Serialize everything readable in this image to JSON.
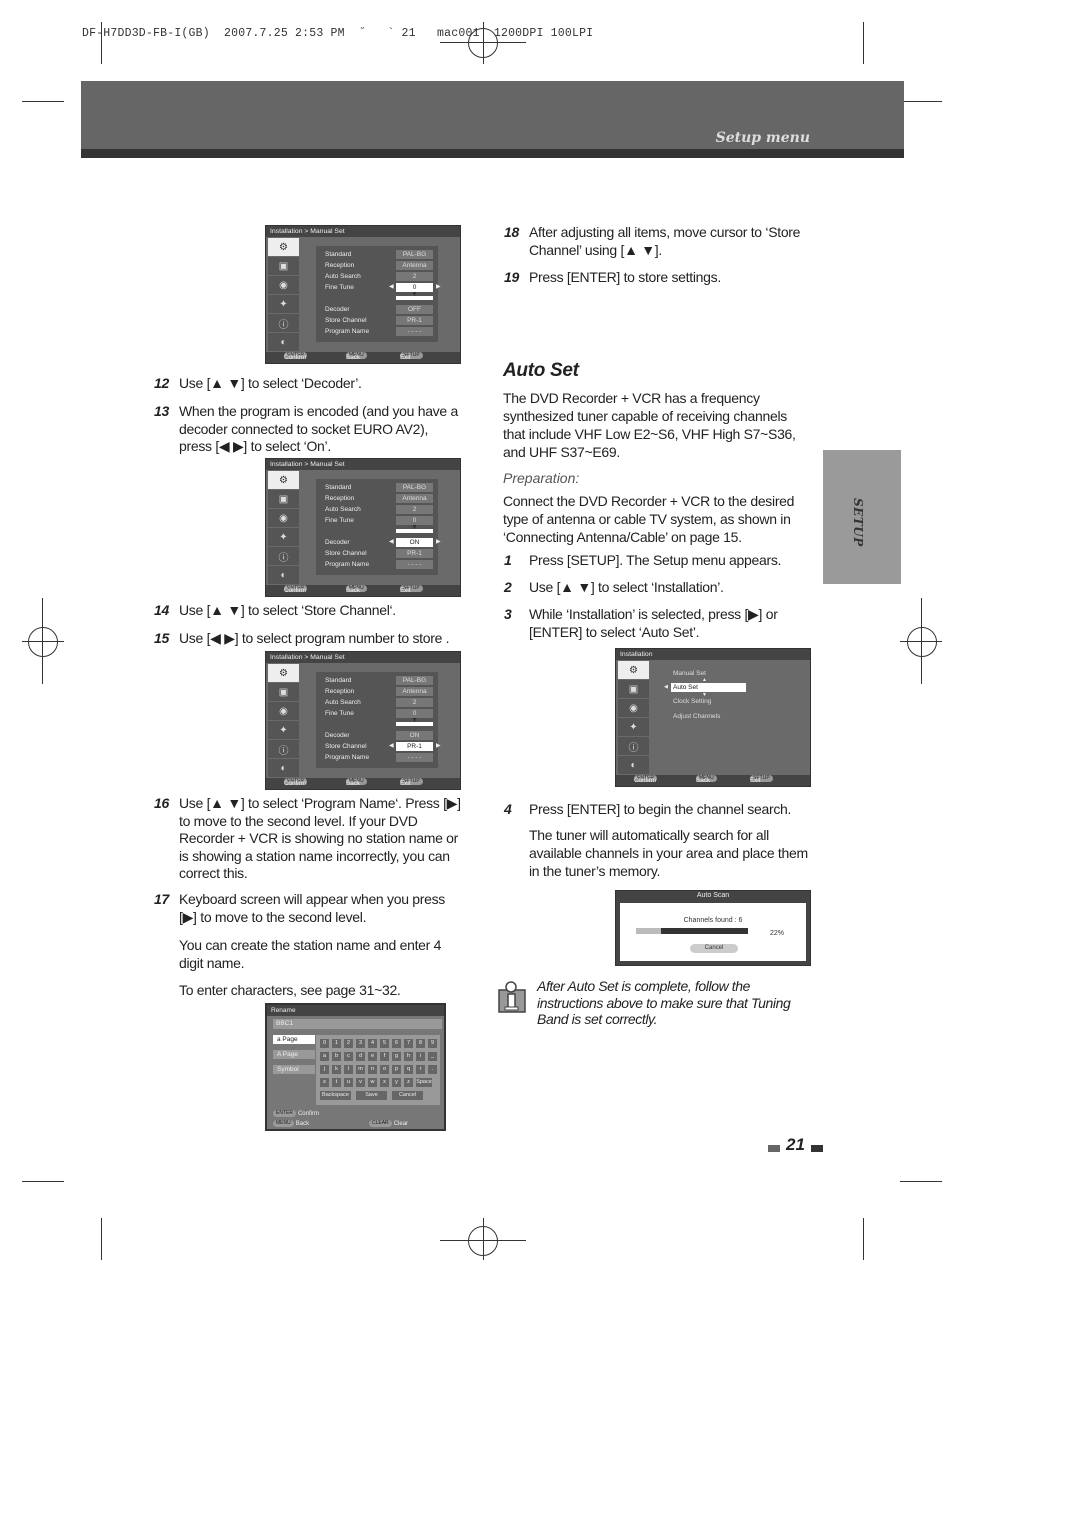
{
  "slug": "DF-H7DD3D-FB-I(GB)  2007.7.25 2:53 PM  ˘   ` 21   mac001  1200DPI 100LPI",
  "header": {
    "section_title": "Setup menu"
  },
  "side_tab": {
    "label": "SETUP"
  },
  "left_column": {
    "steps": [
      {
        "num": "12",
        "text": "Use [▲ ▼] to select ‘Decoder’."
      },
      {
        "num": "13",
        "text": "When the program is encoded (and you have a decoder connected to socket EURO AV2), press [◀ ▶] to select ‘On’."
      },
      {
        "num": "14",
        "text": "Use [▲ ▼] to select ‘Store Channel‘."
      },
      {
        "num": "15",
        "text": "Use [◀ ▶] to select program number to store ."
      },
      {
        "num": "16",
        "text": "Use [▲ ▼] to select ‘Program Name‘. Press [▶] to move to the second level. If your DVD Recorder + VCR is showing no station name or is showing a station name incorrectly, you can correct this."
      },
      {
        "num": "17",
        "text": "Keyboard screen will appear when you press [▶] to move to the second level."
      }
    ],
    "para_station": "You can create the station name and enter 4 digit name.",
    "para_chars": "To enter characters, see page 31~32."
  },
  "manual_set_screens": [
    {
      "breadcrumb": "Installation  > Manual Set",
      "rows": [
        {
          "label": "Standard",
          "value": "PAL-BG"
        },
        {
          "label": "Reception",
          "value": "Antenna"
        },
        {
          "label": "Auto Search",
          "value": "2"
        },
        {
          "label": "Fine Tune",
          "value": "0"
        },
        {
          "label": "Decoder",
          "value": "OFF"
        },
        {
          "label": "Store Channel",
          "value": "PR-1"
        },
        {
          "label": "Program Name",
          "value": "- - - -"
        }
      ],
      "selected": "Fine Tune"
    },
    {
      "breadcrumb": "Installation  > Manual Set",
      "rows": [
        {
          "label": "Standard",
          "value": "PAL-BG"
        },
        {
          "label": "Reception",
          "value": "Antenna"
        },
        {
          "label": "Auto Search",
          "value": "2"
        },
        {
          "label": "Fine Tune",
          "value": "0"
        },
        {
          "label": "Decoder",
          "value": "ON"
        },
        {
          "label": "Store Channel",
          "value": "PR-1"
        },
        {
          "label": "Program Name",
          "value": "- - - -"
        }
      ],
      "selected": "Decoder"
    },
    {
      "breadcrumb": "Installation  > Manual Set",
      "rows": [
        {
          "label": "Standard",
          "value": "PAL-BG"
        },
        {
          "label": "Reception",
          "value": "Antenna"
        },
        {
          "label": "Auto Search",
          "value": "2"
        },
        {
          "label": "Fine Tune",
          "value": "0"
        },
        {
          "label": "Decoder",
          "value": "ON"
        },
        {
          "label": "Store Channel",
          "value": "PR-1"
        },
        {
          "label": "Program Name",
          "value": "- - - -"
        }
      ],
      "selected": "Store Channel"
    }
  ],
  "osd_footer": {
    "enter_key": "ENTER",
    "enter_label": "Confirm",
    "menu_key": "MENU",
    "menu_label": "Back",
    "setup_key": "SETUP",
    "setup_label": "Exit"
  },
  "osd_icons": [
    "installation-icon",
    "recording-icon",
    "language-icon",
    "system-icon",
    "info-icon",
    "disc-icon"
  ],
  "rename_screen": {
    "title": "Rename",
    "name_value": "BBC1",
    "pages": [
      "a Page",
      "A Page",
      "Symbol"
    ],
    "selected_page": "a Page",
    "keys": [
      [
        "0",
        "1",
        "2",
        "3",
        "4",
        "5",
        "6",
        "7",
        "8",
        "9"
      ],
      [
        "a",
        "b",
        "c",
        "d",
        "e",
        "f",
        "g",
        "h",
        "i",
        "_"
      ],
      [
        "j",
        "k",
        "l",
        "m",
        "n",
        "o",
        "p",
        "q",
        "r",
        "."
      ],
      [
        "s",
        "t",
        "u",
        "v",
        "w",
        "x",
        "y",
        "z",
        "Space"
      ]
    ],
    "actions": [
      "Backspace",
      "Save",
      "Cancel"
    ],
    "footer": {
      "enter_key": "ENTER",
      "enter_label": "Confirm",
      "menu_key": "MENU",
      "menu_label": "Back",
      "clear_key": "CLEAR",
      "clear_label": "Clear"
    }
  },
  "right_column": {
    "steps_top": [
      {
        "num": "18",
        "text": "After adjusting all items, move cursor to ‘Store Channel’ using [▲ ▼]."
      },
      {
        "num": "19",
        "text": "Press [ENTER] to store settings."
      }
    ],
    "section_title": "Auto Set",
    "intro": "The DVD Recorder + VCR has a frequency synthesized tuner capable of receiving channels that include VHF Low E2~S6, VHF High S7~S36, and UHF S37~E69.",
    "prep_title": "Preparation:",
    "prep_text": "Connect the DVD Recorder + VCR to the desired type of antenna or cable TV system, as shown in ‘Connecting Antenna/Cable’ on page 15.",
    "steps": [
      {
        "num": "1",
        "text": "Press [SETUP]. The Setup menu appears."
      },
      {
        "num": "2",
        "text": "Use [▲ ▼] to select ‘Installation’."
      },
      {
        "num": "3",
        "text": "While ‘Installation’ is selected, press [▶] or [ENTER] to select ‘Auto Set’."
      },
      {
        "num": "4",
        "text": "Press [ENTER] to begin the channel search."
      }
    ],
    "tuner_text": "The tuner will automatically search for all available channels in your area and place them in the tuner’s memory.",
    "note": "After Auto Set is complete, follow the instructions above to make sure that Tuning Band is set correctly."
  },
  "installation_screen": {
    "title": "Installation",
    "items": [
      "Manual Set",
      "Auto Set",
      "Clock Setting",
      "Adjust Channels"
    ],
    "selected": "Auto Set"
  },
  "auto_scan": {
    "title": "Auto Scan",
    "channels_found": "Channels found : 6",
    "progress_percent": 22,
    "progress_label": "22%",
    "cancel_label": "Cancel"
  },
  "page_number": "21",
  "colors": {
    "header_band": "#666666",
    "header_strip": "#333333",
    "side_tab": "#9a9a9a",
    "osd_bg": "#6a6a6a"
  }
}
